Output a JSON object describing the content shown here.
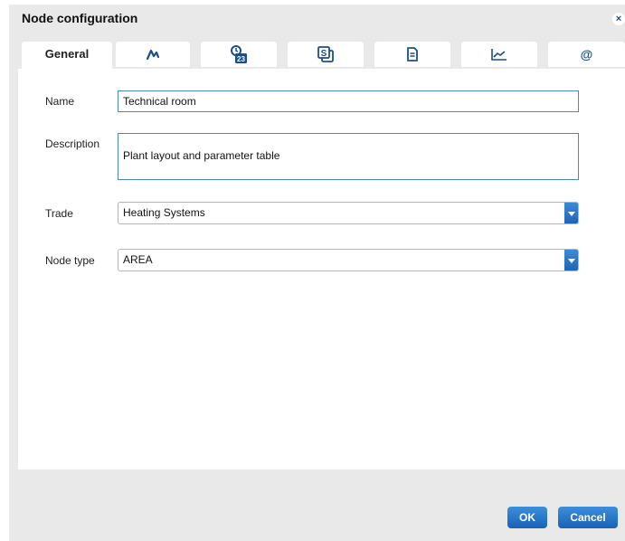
{
  "dialog": {
    "title": "Node configuration",
    "close_glyph": "×"
  },
  "tabs": [
    {
      "label": "General",
      "icon": null,
      "active": true
    },
    {
      "icon": "trend-curve-icon"
    },
    {
      "icon": "calendar-clock-icon",
      "badge": "23"
    },
    {
      "icon": "stacked-documents-icon",
      "badge": "S"
    },
    {
      "icon": "document-icon"
    },
    {
      "icon": "line-chart-icon"
    },
    {
      "icon": "at-sign-icon",
      "glyph": "@"
    }
  ],
  "form": {
    "name_label": "Name",
    "name_value": "Technical room",
    "description_label": "Description",
    "description_value": "Plant layout and parameter table",
    "trade_label": "Trade",
    "trade_value": "Heating Systems",
    "node_type_label": "Node type",
    "node_type_value": "AREA"
  },
  "buttons": {
    "ok": "OK",
    "cancel": "Cancel"
  },
  "colors": {
    "accent": "#1f6fc1",
    "dialog_bg": "#e9e9e9",
    "input_border": "#4a88c2"
  }
}
